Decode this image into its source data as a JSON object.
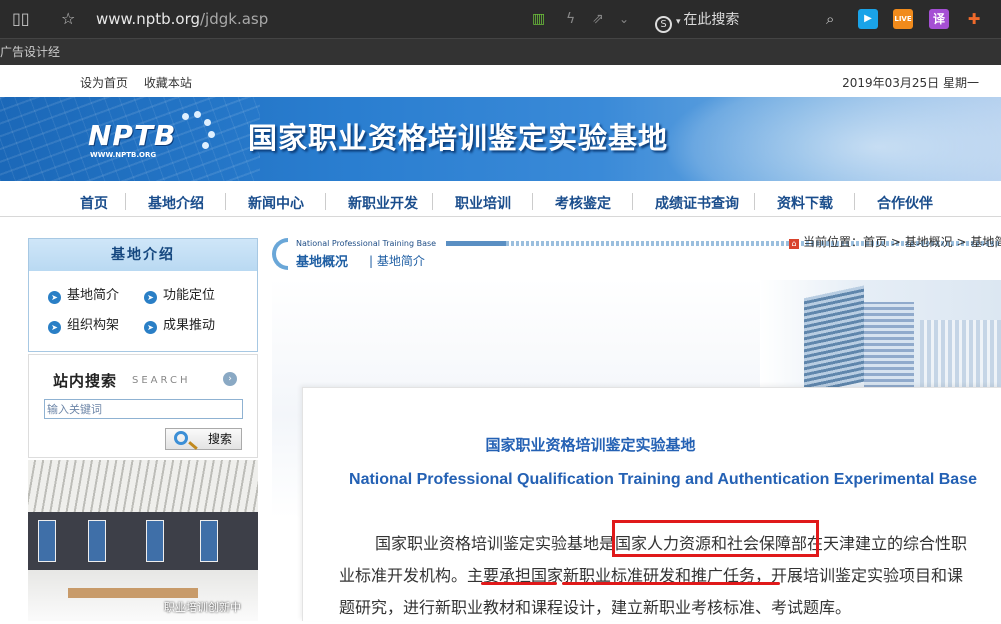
{
  "browser": {
    "url_host": "www.nptb.org",
    "url_path": "/jdgk.asp",
    "search_placeholder": "在此搜索",
    "bookmark": "广告设计经",
    "extensions": [
      "LIVE",
      "译"
    ]
  },
  "topbar": {
    "set_home": "设为首页",
    "bookmark_site": "收藏本站",
    "date": "2019年03月25日 星期一"
  },
  "banner": {
    "logo": "NPTB",
    "logo_sub": "WWW.NPTB.ORG",
    "title": "国家职业资格培训鉴定实验基地"
  },
  "nav": [
    "首页",
    "基地介绍",
    "新闻中心",
    "新职业开发",
    "职业培训",
    "考核鉴定",
    "成绩证书查询",
    "资料下载",
    "合作伙伴"
  ],
  "sidebar": {
    "heading": "基地介绍",
    "items": [
      "基地简介",
      "功能定位",
      "组织构架",
      "成果推动"
    ],
    "search_title": "站内搜索",
    "search_en": "SEARCH",
    "search_placeholder": "输入关键词",
    "search_button": "搜索",
    "photo_caption": "职业培训创新中"
  },
  "breadcrumb": {
    "en": "National Professional Training Base",
    "section": "基地概况",
    "page": "基地简介",
    "location": "当前位置：首页 > 基地概况 > 基地简介"
  },
  "article": {
    "title_cn": "国家职业资格培训鉴定实验基地",
    "title_en": "National Professional Qualification Training and  Authentication Experimental Base",
    "paragraph": "国家职业资格培训鉴定实验基地是国家人力资源和社会保障部在天津建立的综合性职业标准开发机构。主要承担国家新职业标准研发和推广任务，开展培训鉴定实验项目和课题研究，进行新职业教材和课程设计，建立新职业考核标准、考试题库。"
  },
  "colors": {
    "accent": "#2461b4",
    "nav": "#1a4d8c",
    "highlight": "#e0191a"
  }
}
